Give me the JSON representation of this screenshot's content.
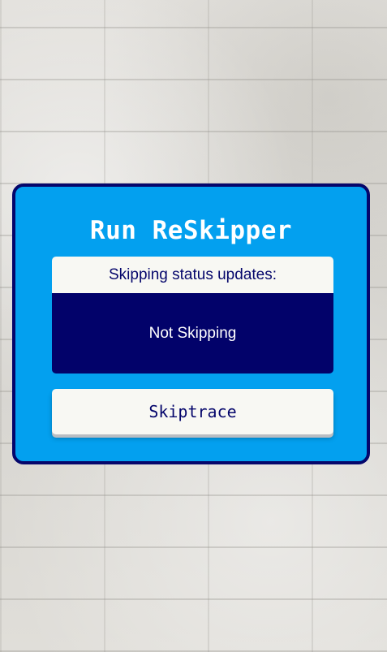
{
  "card": {
    "title": "Run ReSkipper"
  },
  "status": {
    "header": "Skipping status updates:",
    "value": "Not Skipping"
  },
  "actions": {
    "skiptrace_label": "Skiptrace"
  },
  "colors": {
    "card_background": "#03a0ef",
    "card_border": "#05066b",
    "status_body": "#02026a",
    "light_panel": "#f8f8f3",
    "text_dark": "#05066b",
    "text_light": "#ffffff"
  }
}
